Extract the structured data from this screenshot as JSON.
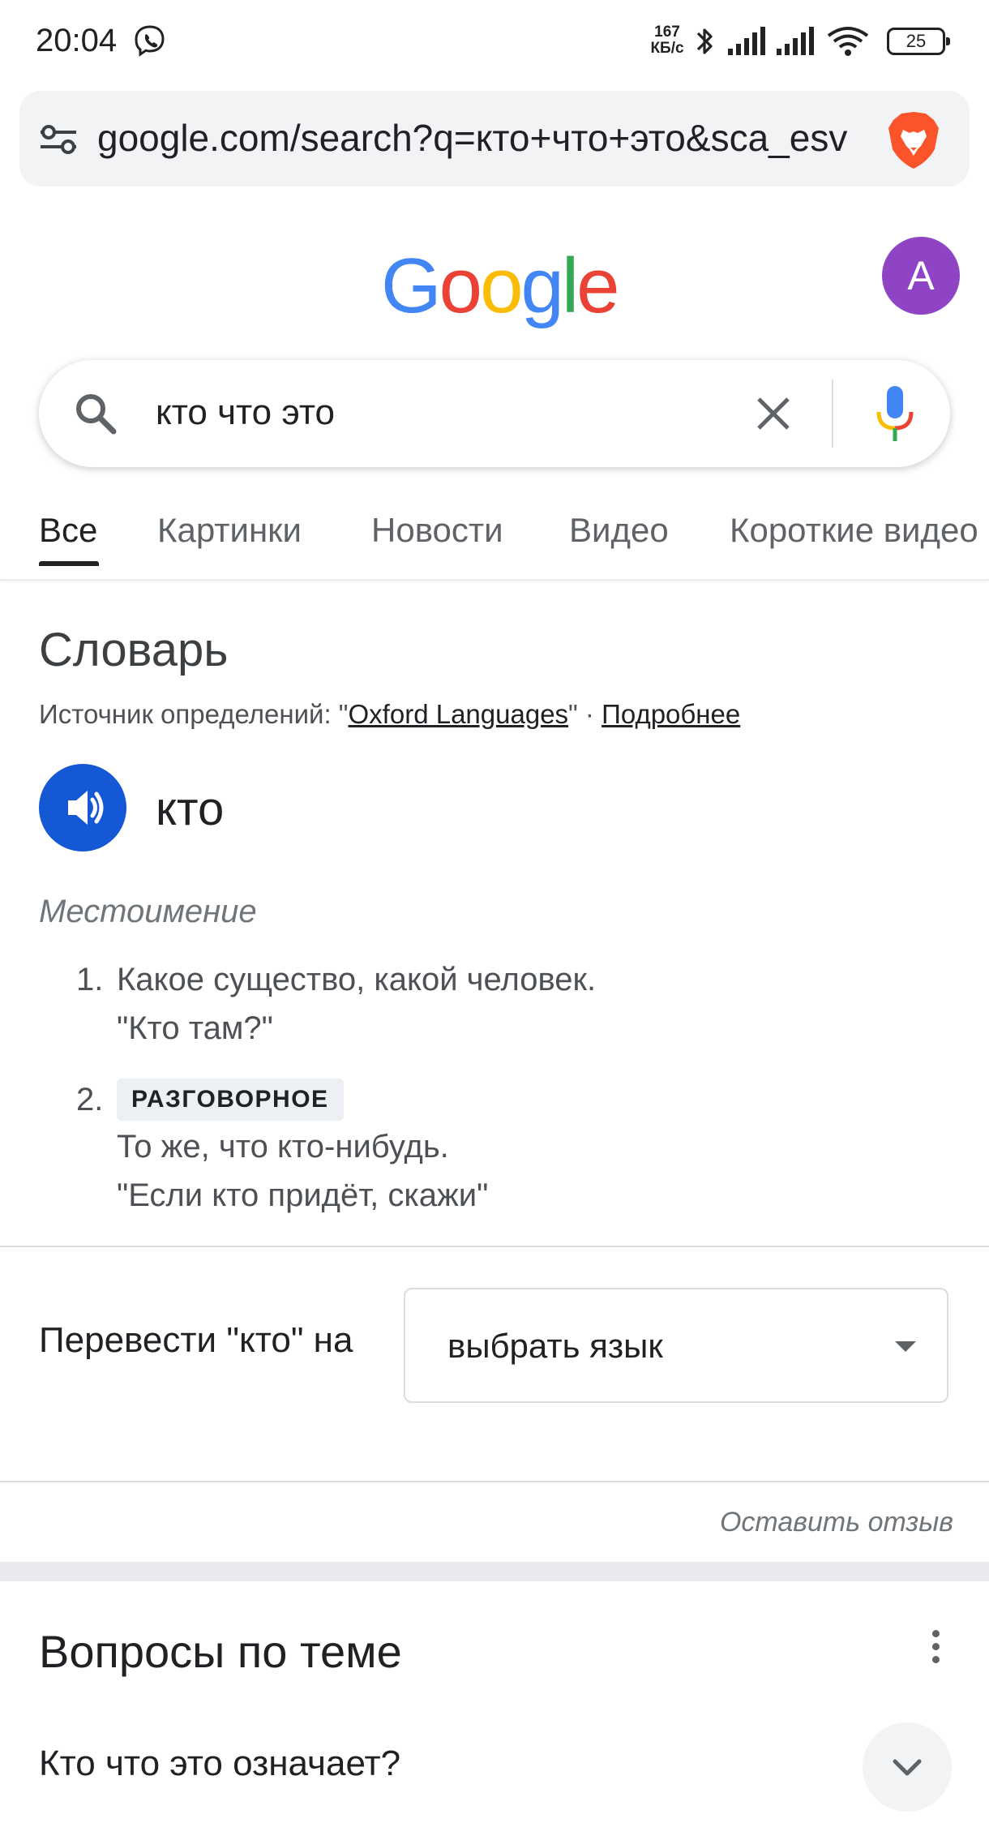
{
  "status_bar": {
    "time": "20:04",
    "net_speed_value": "167",
    "net_speed_unit": "КБ/с",
    "battery": "25"
  },
  "browser": {
    "url": "google.com/search?q=кто+что+это&sca_esv"
  },
  "header": {
    "logo": "Google",
    "avatar_letter": "A"
  },
  "search": {
    "query": "кто что это"
  },
  "tabs": [
    {
      "label": "Все",
      "active": true
    },
    {
      "label": "Картинки"
    },
    {
      "label": "Новости"
    },
    {
      "label": "Видео"
    },
    {
      "label": "Короткие видео"
    }
  ],
  "dictionary": {
    "title": "Словарь",
    "source_prefix": "Источник определений: \"",
    "source_name": "Oxford Languages",
    "source_suffix": "\" · ",
    "more_link": "Подробнее",
    "word": "кто",
    "part_of_speech": "Местоимение",
    "definitions": [
      {
        "num": "1.",
        "text": "Какое существо, какой человек.",
        "example": "\"Кто там?\""
      },
      {
        "num": "2.",
        "label": "РАЗГОВОРНОЕ",
        "text": "То же, что кто-нибудь.",
        "example": "\"Если кто придёт, скажи\""
      }
    ]
  },
  "translate": {
    "label": "Перевести \"кто\" на",
    "select_value": "выбрать язык"
  },
  "feedback": "Оставить отзыв",
  "related": {
    "title": "Вопросы по теме",
    "questions": [
      "Кто что это означает?"
    ]
  },
  "colors": {
    "speaker_bg": "#1558d6",
    "avatar_bg": "#8e44c5",
    "logo_blue": "#4285F4",
    "logo_red": "#EA4335",
    "logo_yellow": "#FBBC05",
    "logo_green": "#34A853"
  }
}
